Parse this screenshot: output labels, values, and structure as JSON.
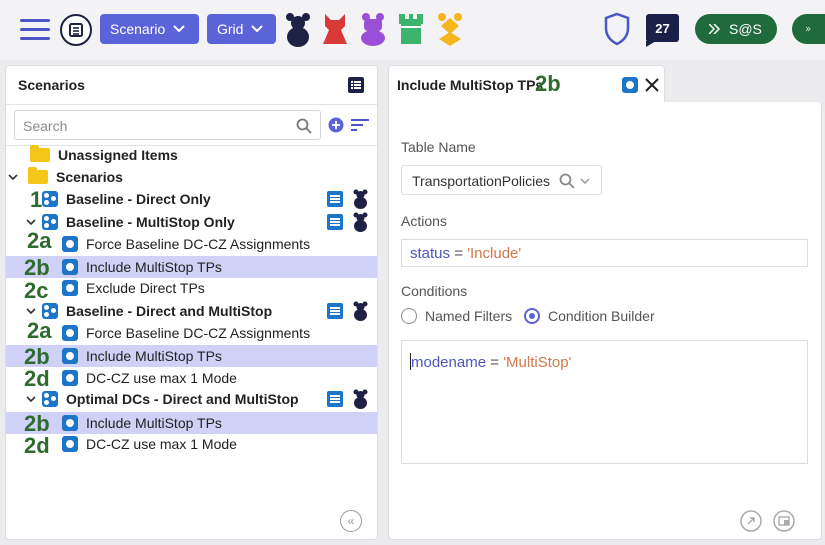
{
  "topbar": {
    "scenario_label": "Scenario",
    "grid_label": "Grid",
    "notif_count": "27",
    "run_label_1": "S@S",
    "colors": {
      "accent": "#5b63d8",
      "green": "#1f6b3b",
      "navy": "#1d2244"
    },
    "pieces": [
      "navy-bear-icon",
      "red-piece-icon",
      "purple-piece-icon",
      "green-tower-icon",
      "yellow-piece-icon"
    ]
  },
  "left": {
    "title": "Scenarios",
    "search_placeholder": "Search",
    "tree": [
      {
        "label": "Unassigned Items",
        "type": "folder",
        "bold": true
      },
      {
        "label": "Scenarios",
        "type": "folder",
        "bold": true
      },
      {
        "label": "Baseline - Direct Only",
        "type": "scenario",
        "bold": true,
        "tag": "1"
      },
      {
        "label": "Baseline - MultiStop Only",
        "type": "scenario",
        "bold": true
      },
      {
        "label": "Force Baseline DC-CZ Assignments",
        "type": "item",
        "tag": "2a"
      },
      {
        "label": "Include MultiStop TPs",
        "type": "item",
        "tag": "2b",
        "selected": true
      },
      {
        "label": "Exclude Direct TPs",
        "type": "item",
        "tag": "2c"
      },
      {
        "label": "Baseline - Direct and MultiStop",
        "type": "scenario",
        "bold": true
      },
      {
        "label": "Force Baseline DC-CZ Assignments",
        "type": "item",
        "tag": "2a"
      },
      {
        "label": "Include MultiStop TPs",
        "type": "item",
        "tag": "2b",
        "selected": true
      },
      {
        "label": "DC-CZ use max 1 Mode",
        "type": "item",
        "tag": "2d"
      },
      {
        "label": "Optimal DCs - Direct and MultiStop",
        "type": "scenario",
        "bold": true
      },
      {
        "label": "Include MultiStop TPs",
        "type": "item",
        "tag": "2b",
        "selected": true
      },
      {
        "label": "DC-CZ use max 1 Mode",
        "type": "item",
        "tag": "2d"
      }
    ]
  },
  "right": {
    "tab_title": "Include MultiStop TPs",
    "tab_tag": "2b",
    "table_name_label": "Table Name",
    "table_name_value": "TransportationPolicies",
    "actions_label": "Actions",
    "action_kw": "status",
    "action_eq": " = ",
    "action_val": "'Include'",
    "conditions_label": "Conditions",
    "named_filters_label": "Named Filters",
    "condition_builder_label": "Condition Builder",
    "cond_kw": "modename",
    "cond_eq": " = ",
    "cond_val": "'MultiStop'"
  }
}
